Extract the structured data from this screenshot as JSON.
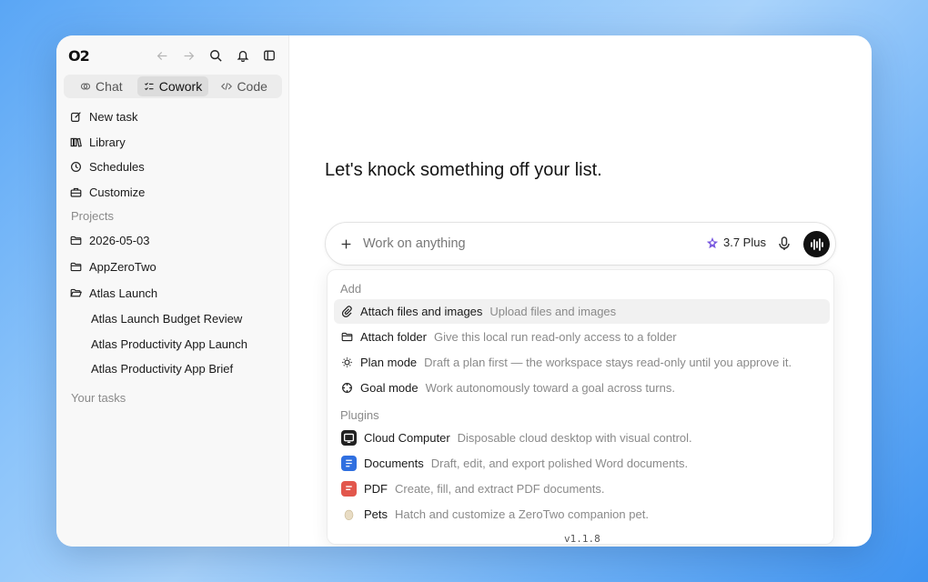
{
  "sidebar": {
    "logo": "O2",
    "tabs": [
      {
        "label": "Chat",
        "icon": "chat-icon"
      },
      {
        "label": "Cowork",
        "icon": "checklist-icon",
        "active": true
      },
      {
        "label": "Code",
        "icon": "code-icon"
      }
    ],
    "nav": [
      {
        "label": "New task",
        "icon": "edit-icon"
      },
      {
        "label": "Library",
        "icon": "library-icon"
      },
      {
        "label": "Schedules",
        "icon": "clock-icon"
      },
      {
        "label": "Customize",
        "icon": "briefcase-icon"
      }
    ],
    "projects_label": "Projects",
    "projects": [
      {
        "label": "2026-05-03",
        "icon": "folder-icon"
      },
      {
        "label": "AppZeroTwo",
        "icon": "folder-icon"
      },
      {
        "label": "Atlas Launch",
        "icon": "folder-open-icon"
      }
    ],
    "project_tasks": [
      "Atlas Launch Budget Review",
      "Atlas Productivity App Launch",
      "Atlas Productivity App Brief"
    ],
    "tasks_label": "Your tasks"
  },
  "main": {
    "headline": "Let's knock something off your list.",
    "composer": {
      "placeholder": "Work on anything",
      "model": "3.7 Plus"
    },
    "menu": {
      "add_label": "Add",
      "add_items": [
        {
          "title": "Attach files and images",
          "desc": "Upload files and images",
          "icon": "paperclip-icon"
        },
        {
          "title": "Attach folder",
          "desc": "Give this local run read-only access to a folder",
          "icon": "folder-icon"
        },
        {
          "title": "Plan mode",
          "desc": "Draft a plan first — the workspace stays read-only until you approve it.",
          "icon": "lightbulb-icon"
        },
        {
          "title": "Goal mode",
          "desc": "Work autonomously toward a goal across turns.",
          "icon": "target-icon"
        }
      ],
      "plugins_label": "Plugins",
      "plugins": [
        {
          "title": "Cloud Computer",
          "desc": "Disposable cloud desktop with visual control.",
          "icon": "cloud-computer-icon",
          "color": "#222222"
        },
        {
          "title": "Documents",
          "desc": "Draft, edit, and export polished Word documents.",
          "icon": "document-icon",
          "color": "#2f6fe0"
        },
        {
          "title": "PDF",
          "desc": "Create, fill, and extract PDF documents.",
          "icon": "pdf-icon",
          "color": "#e2574c"
        },
        {
          "title": "Pets",
          "desc": "Hatch and customize a ZeroTwo companion pet.",
          "icon": "egg-icon",
          "color": "#e8dcc4"
        }
      ],
      "version": "v1.1.8"
    }
  }
}
